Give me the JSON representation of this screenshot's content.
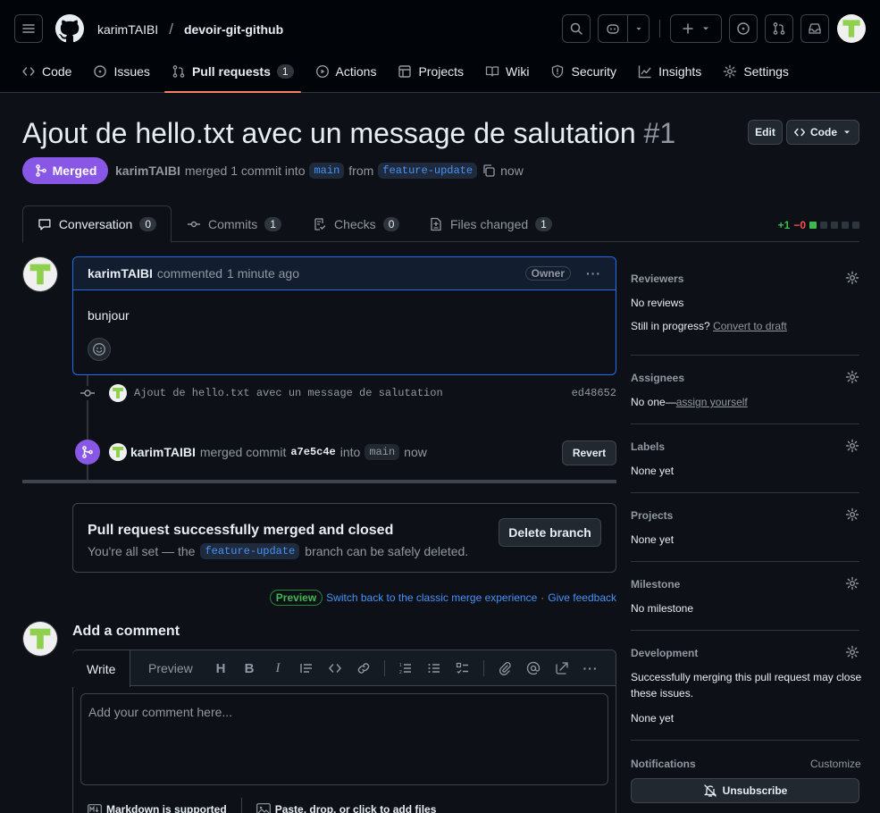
{
  "header": {
    "owner": "karimTAIBI",
    "separator": "/",
    "repo": "devoir-git-github"
  },
  "nav": {
    "tabs": [
      {
        "label": "Code",
        "icon": "code-icon"
      },
      {
        "label": "Issues",
        "icon": "issue-icon"
      },
      {
        "label": "Pull requests",
        "icon": "pull-request-icon",
        "count": "1",
        "active": true
      },
      {
        "label": "Actions",
        "icon": "play-icon"
      },
      {
        "label": "Projects",
        "icon": "table-icon"
      },
      {
        "label": "Wiki",
        "icon": "book-icon"
      },
      {
        "label": "Security",
        "icon": "shield-icon"
      },
      {
        "label": "Insights",
        "icon": "graph-icon"
      },
      {
        "label": "Settings",
        "icon": "gear-icon"
      }
    ]
  },
  "pr": {
    "title": "Ajout de hello.txt avec un message de salutation",
    "number": "#1",
    "edit_label": "Edit",
    "code_label": "Code",
    "state": "Merged",
    "author": "karimTAIBI",
    "summary_mid": "merged 1 commit into",
    "base": "main",
    "from": "from",
    "head": "feature-update",
    "time": "now"
  },
  "pr_tabs": [
    {
      "label": "Conversation",
      "count": "0"
    },
    {
      "label": "Commits",
      "count": "1"
    },
    {
      "label": "Checks",
      "count": "0"
    },
    {
      "label": "Files changed",
      "count": "1"
    }
  ],
  "diffstat": {
    "added": "+1",
    "removed": "−0"
  },
  "comment": {
    "author": "karimTAIBI",
    "action": "commented",
    "time": "1 minute ago",
    "role": "Owner",
    "body": "bunjour"
  },
  "commit": {
    "message": "Ajout de hello.txt avec un message de salutation",
    "sha": "ed48652"
  },
  "merge_event": {
    "author": "karimTAIBI",
    "text1": "merged commit",
    "sha": "a7e5c4e",
    "text2": "into",
    "branch": "main",
    "time": "now",
    "revert_label": "Revert"
  },
  "merged_box": {
    "heading": "Pull request successfully merged and closed",
    "text_before": "You're all set — the",
    "branch": "feature-update",
    "text_after": "branch can be safely deleted.",
    "delete_label": "Delete branch"
  },
  "preview": {
    "label": "Preview",
    "switch_link": "Switch back to the classic merge experience",
    "dot": "·",
    "feedback_link": "Give feedback"
  },
  "add_comment": {
    "title": "Add a comment",
    "write_tab": "Write",
    "preview_tab": "Preview",
    "placeholder": "Add your comment here...",
    "markdown_note": "Markdown is supported",
    "attach_note": "Paste, drop, or click to add files"
  },
  "sidebar": {
    "reviewers": {
      "title": "Reviewers",
      "value": "No reviews",
      "progress": "Still in progress?",
      "convert": "Convert to draft"
    },
    "assignees": {
      "title": "Assignees",
      "none": "No one—",
      "assign": "assign yourself"
    },
    "labels": {
      "title": "Labels",
      "value": "None yet"
    },
    "projects": {
      "title": "Projects",
      "value": "None yet"
    },
    "milestone": {
      "title": "Milestone",
      "value": "No milestone"
    },
    "development": {
      "title": "Development",
      "line1": "Successfully merging this pull request may close",
      "line2": "these issues.",
      "value": "None yet"
    },
    "notifications": {
      "title": "Notifications",
      "customize": "Customize",
      "unsubscribe": "Unsubscribe"
    }
  },
  "colors": {
    "accent": "#f78166",
    "merged": "#8957e5",
    "link": "#4493f8",
    "added": "#3fb950",
    "removed": "#f85149"
  }
}
